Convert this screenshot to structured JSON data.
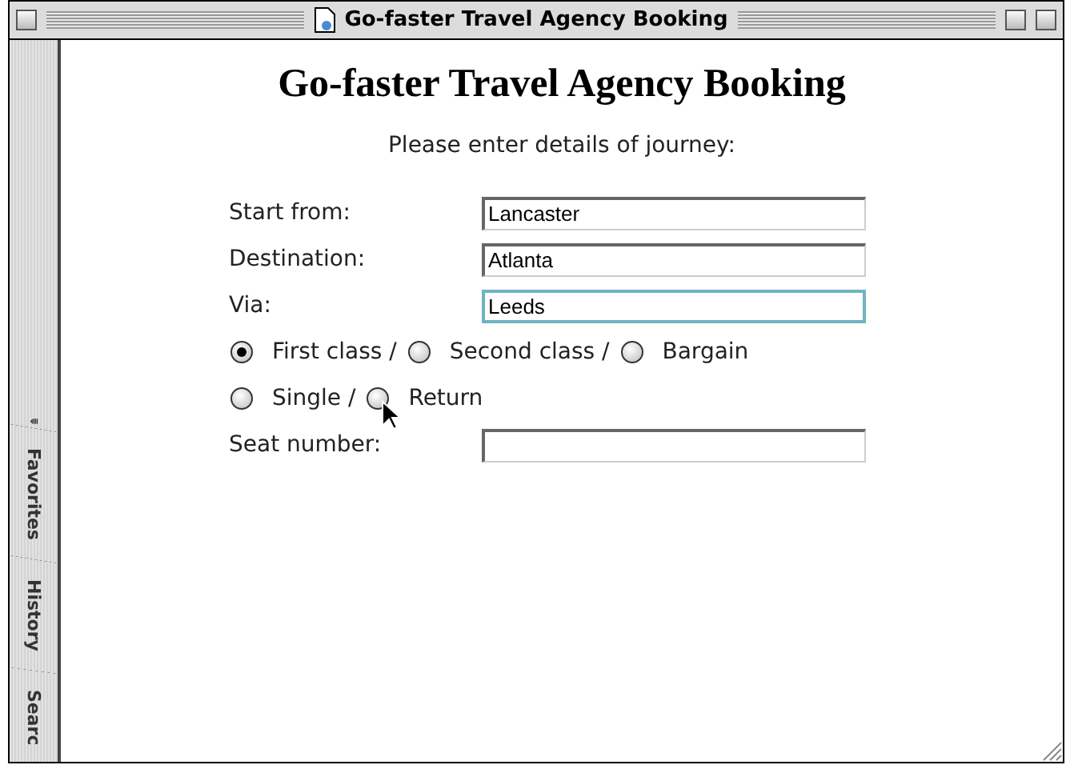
{
  "window": {
    "title": "Go-faster Travel Agency Booking"
  },
  "sidebar": {
    "tabs": [
      {
        "label": "Favorites"
      },
      {
        "label": "History"
      },
      {
        "label": "Searc"
      }
    ]
  },
  "page": {
    "heading": "Go-faster Travel Agency Booking",
    "intro": "Please enter details of journey:",
    "rows": [
      {
        "kind": "field",
        "label": "Start from:",
        "value": "Lancaster",
        "focused": false
      },
      {
        "kind": "field",
        "label": "Destination:",
        "value": "Atlanta",
        "focused": false
      },
      {
        "kind": "field",
        "label": "Via:",
        "value": "Leeds",
        "focused": true
      },
      {
        "kind": "radios",
        "options": [
          {
            "label": "First class /",
            "selected": true
          },
          {
            "label": "Second class /",
            "selected": false
          },
          {
            "label": "Bargain",
            "selected": false
          }
        ]
      },
      {
        "kind": "radios",
        "options": [
          {
            "label": "Single /",
            "selected": false
          },
          {
            "label": "Return",
            "selected": false
          }
        ]
      },
      {
        "kind": "field",
        "label": "Seat number:",
        "focused": false
      }
    ]
  }
}
